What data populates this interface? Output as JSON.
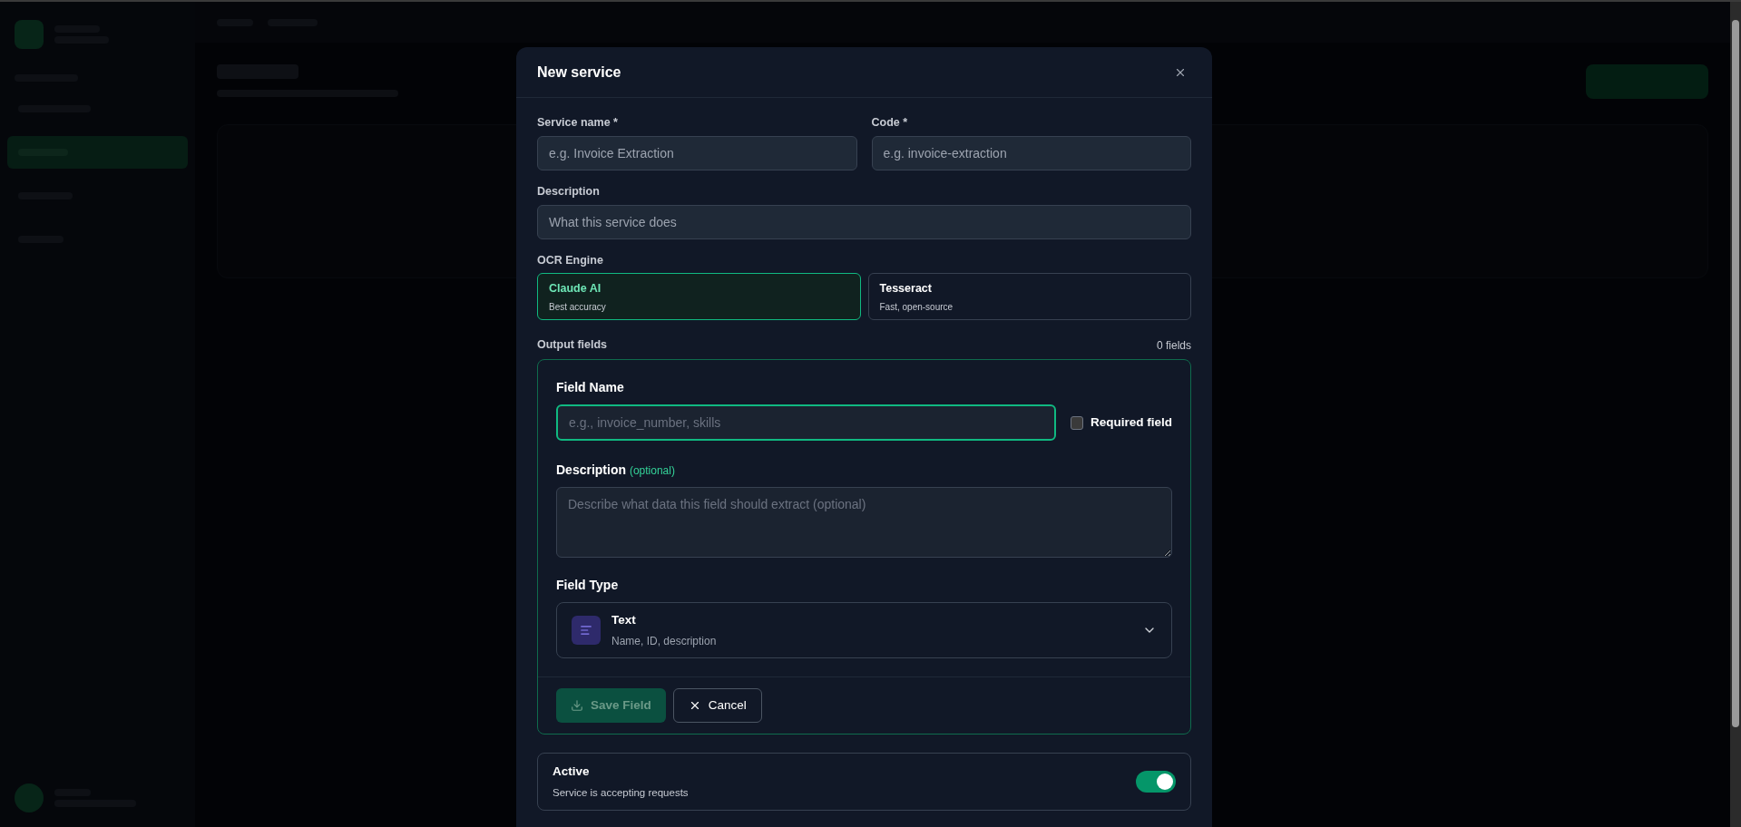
{
  "modal": {
    "title": "New service",
    "fields": [
      {
        "label": "Service name *",
        "placeholder": "e.g. Invoice Extraction"
      },
      {
        "label": "Code *",
        "placeholder": "e.g. invoice-extraction"
      }
    ],
    "description": {
      "label": "Description",
      "placeholder": "What this service does"
    },
    "ocr_engine": {
      "label": "OCR Engine",
      "options": [
        {
          "name": "Claude AI",
          "detail": "Best accuracy",
          "selected": true
        },
        {
          "name": "Tesseract",
          "detail": "Fast, open-source",
          "selected": false
        }
      ]
    },
    "output_fields": {
      "label": "Output fields",
      "count": "0 fields",
      "field_name": {
        "label": "Field Name",
        "placeholder": "e.g., invoice_number, skills",
        "focused": true
      },
      "required": {
        "label": "Required field",
        "checked": false
      },
      "field_description": {
        "label": "Description",
        "hint": "(optional)",
        "placeholder": "Describe what data this field should extract (optional)"
      },
      "field_type": {
        "label": "Field Type",
        "value": "Text",
        "detail": "Name, ID, description"
      },
      "buttons": [
        {
          "label": "Save Field",
          "kind": "primary",
          "disabled": true
        },
        {
          "label": "Cancel",
          "kind": "secondary",
          "disabled": false
        }
      ]
    },
    "active": {
      "label": "Active",
      "detail": "Service is accepting requests",
      "on": true
    }
  }
}
